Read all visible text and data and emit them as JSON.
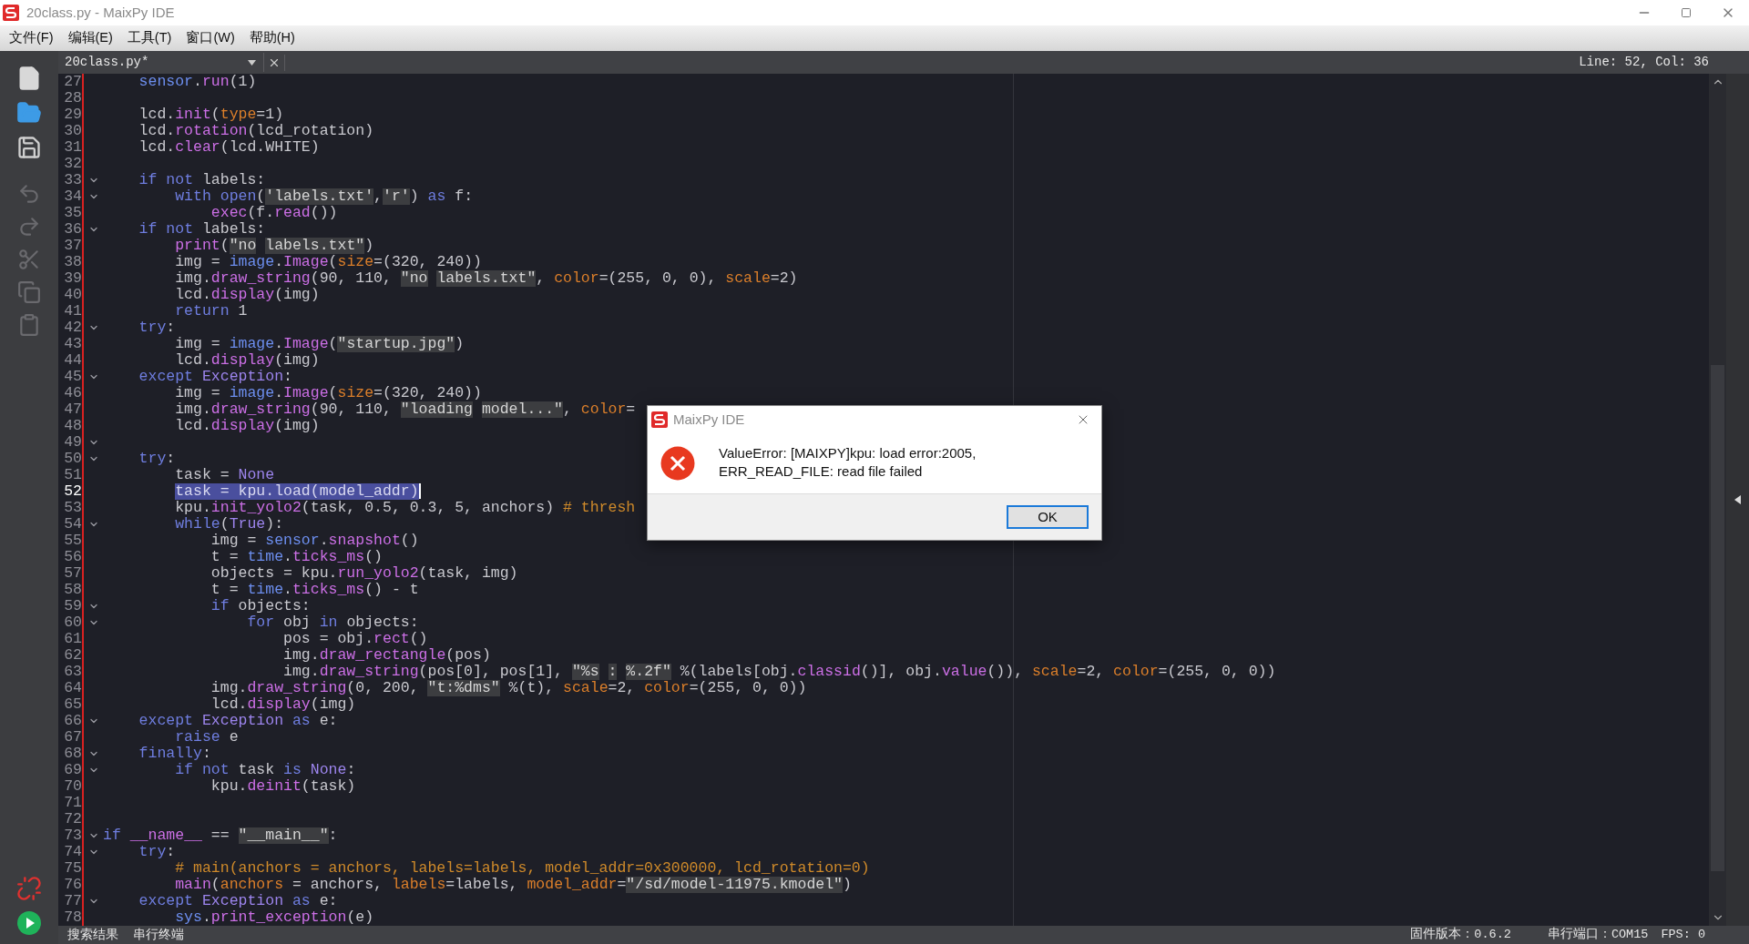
{
  "window": {
    "title": "20class.py - MaixPy IDE"
  },
  "menu": [
    "文件(F)",
    "编辑(E)",
    "工具(T)",
    "窗口(W)",
    "帮助(H)"
  ],
  "editor": {
    "tab": "20class.py*",
    "position": "Line: 52, Col: 36",
    "lines": [
      {
        "number": "27",
        "fold": false,
        "selected": false,
        "tokens": [
          {
            "kind": "module",
            "text": "    sensor"
          },
          {
            "kind": "plain",
            "text": "."
          },
          {
            "kind": "function",
            "text": "run"
          },
          {
            "kind": "plain",
            "text": "(1)"
          }
        ]
      },
      {
        "number": "28",
        "fold": false,
        "selected": false
      },
      {
        "number": "29",
        "fold": false,
        "selected": false,
        "tokens": [
          {
            "kind": "plain",
            "text": "    lcd."
          },
          {
            "kind": "function",
            "text": "init"
          },
          {
            "kind": "plain",
            "text": "("
          },
          {
            "kind": "param",
            "text": "type"
          },
          {
            "kind": "plain",
            "text": "=1)"
          }
        ]
      },
      {
        "number": "30",
        "fold": false,
        "selected": false,
        "tokens": [
          {
            "kind": "plain",
            "text": "    lcd."
          },
          {
            "kind": "function",
            "text": "rotation"
          },
          {
            "kind": "plain",
            "text": "(lcd_rotation)"
          }
        ]
      },
      {
        "number": "31",
        "fold": false,
        "selected": false,
        "tokens": [
          {
            "kind": "plain",
            "text": "    lcd."
          },
          {
            "kind": "function",
            "text": "clear"
          },
          {
            "kind": "plain",
            "text": "(lcd.WHITE)"
          }
        ]
      },
      {
        "number": "32",
        "fold": false,
        "selected": false
      },
      {
        "number": "33",
        "fold": true,
        "selected": false,
        "tokens": [
          {
            "kind": "keyword",
            "text": "    if"
          },
          {
            "kind": "keyword",
            "text": " not"
          },
          {
            "kind": "plain",
            "text": " labels:"
          }
        ]
      },
      {
        "number": "34",
        "fold": true,
        "selected": false,
        "tokens": [
          {
            "kind": "keyword",
            "text": "        with"
          },
          {
            "kind": "keyword",
            "text": " open"
          },
          {
            "kind": "plain",
            "text": "("
          },
          {
            "kind": "string",
            "text": "'labels.txt'"
          },
          {
            "kind": "plain",
            "text": ","
          },
          {
            "kind": "string",
            "text": "'r'"
          },
          {
            "kind": "plain",
            "text": ")"
          },
          {
            "kind": "keyword",
            "text": " as"
          },
          {
            "kind": "plain",
            "text": " f:"
          }
        ]
      },
      {
        "number": "35",
        "fold": false,
        "selected": false,
        "tokens": [
          {
            "kind": "function",
            "text": "            exec"
          },
          {
            "kind": "plain",
            "text": "(f."
          },
          {
            "kind": "function",
            "text": "read"
          },
          {
            "kind": "plain",
            "text": "())"
          }
        ]
      },
      {
        "number": "36",
        "fold": true,
        "selected": false,
        "tokens": [
          {
            "kind": "keyword",
            "text": "    if"
          },
          {
            "kind": "keyword",
            "text": " not"
          },
          {
            "kind": "plain",
            "text": " labels:"
          }
        ]
      },
      {
        "number": "37",
        "fold": false,
        "selected": false,
        "tokens": [
          {
            "kind": "function",
            "text": "        print"
          },
          {
            "kind": "plain",
            "text": "("
          },
          {
            "kind": "string",
            "text": "\"no"
          },
          {
            "kind": "string",
            "text": " labels.txt\""
          },
          {
            "kind": "plain",
            "text": ")"
          }
        ]
      },
      {
        "number": "38",
        "fold": false,
        "selected": false,
        "tokens": [
          {
            "kind": "plain",
            "text": "        img = "
          },
          {
            "kind": "module",
            "text": "image"
          },
          {
            "kind": "plain",
            "text": "."
          },
          {
            "kind": "function",
            "text": "Image"
          },
          {
            "kind": "plain",
            "text": "("
          },
          {
            "kind": "param",
            "text": "size"
          },
          {
            "kind": "plain",
            "text": "=(320, 240))"
          }
        ]
      },
      {
        "number": "39",
        "fold": false,
        "selected": false,
        "tokens": [
          {
            "kind": "plain",
            "text": "        img."
          },
          {
            "kind": "function",
            "text": "draw_string"
          },
          {
            "kind": "plain",
            "text": "(90, 110, "
          },
          {
            "kind": "string",
            "text": "\"no"
          },
          {
            "kind": "string",
            "text": " labels.txt\""
          },
          {
            "kind": "plain",
            "text": ", "
          },
          {
            "kind": "param",
            "text": "color"
          },
          {
            "kind": "plain",
            "text": "=(255, 0, 0), "
          },
          {
            "kind": "param",
            "text": "scale"
          },
          {
            "kind": "plain",
            "text": "=2)"
          }
        ]
      },
      {
        "number": "40",
        "fold": false,
        "selected": false,
        "tokens": [
          {
            "kind": "plain",
            "text": "        lcd."
          },
          {
            "kind": "function",
            "text": "display"
          },
          {
            "kind": "plain",
            "text": "(img)"
          }
        ]
      },
      {
        "number": "41",
        "fold": false,
        "selected": false,
        "tokens": [
          {
            "kind": "keyword",
            "text": "        return"
          },
          {
            "kind": "plain",
            "text": " 1"
          }
        ]
      },
      {
        "number": "42",
        "fold": true,
        "selected": false,
        "tokens": [
          {
            "kind": "keyword",
            "text": "    try"
          },
          {
            "kind": "plain",
            "text": ":"
          }
        ]
      },
      {
        "number": "43",
        "fold": false,
        "selected": false,
        "tokens": [
          {
            "kind": "plain",
            "text": "        img = "
          },
          {
            "kind": "module",
            "text": "image"
          },
          {
            "kind": "plain",
            "text": "."
          },
          {
            "kind": "function",
            "text": "Image"
          },
          {
            "kind": "plain",
            "text": "("
          },
          {
            "kind": "string",
            "text": "\"startup.jpg\""
          },
          {
            "kind": "plain",
            "text": ")"
          }
        ]
      },
      {
        "number": "44",
        "fold": false,
        "selected": false,
        "tokens": [
          {
            "kind": "plain",
            "text": "        lcd."
          },
          {
            "kind": "function",
            "text": "display"
          },
          {
            "kind": "plain",
            "text": "(img)"
          }
        ]
      },
      {
        "number": "45",
        "fold": true,
        "selected": false,
        "tokens": [
          {
            "kind": "keyword",
            "text": "    except"
          },
          {
            "kind": "builtin",
            "text": " Exception"
          },
          {
            "kind": "plain",
            "text": ":"
          }
        ]
      },
      {
        "number": "46",
        "fold": false,
        "selected": false,
        "tokens": [
          {
            "kind": "plain",
            "text": "        img = "
          },
          {
            "kind": "module",
            "text": "image"
          },
          {
            "kind": "plain",
            "text": "."
          },
          {
            "kind": "function",
            "text": "Image"
          },
          {
            "kind": "plain",
            "text": "("
          },
          {
            "kind": "param",
            "text": "size"
          },
          {
            "kind": "plain",
            "text": "=(320, 240))"
          }
        ]
      },
      {
        "number": "47",
        "fold": false,
        "selected": false,
        "tokens": [
          {
            "kind": "plain",
            "text": "        img."
          },
          {
            "kind": "function",
            "text": "draw_string"
          },
          {
            "kind": "plain",
            "text": "(90, 110, "
          },
          {
            "kind": "string",
            "text": "\"loading"
          },
          {
            "kind": "string",
            "text": " model...\""
          },
          {
            "kind": "plain",
            "text": ", "
          },
          {
            "kind": "param",
            "text": "color"
          },
          {
            "kind": "plain",
            "text": "="
          }
        ]
      },
      {
        "number": "48",
        "fold": false,
        "selected": false,
        "tokens": [
          {
            "kind": "plain",
            "text": "        lcd."
          },
          {
            "kind": "function",
            "text": "display"
          },
          {
            "kind": "plain",
            "text": "(img)"
          }
        ]
      },
      {
        "number": "49",
        "fold": true,
        "selected": false
      },
      {
        "number": "50",
        "fold": true,
        "selected": false,
        "tokens": [
          {
            "kind": "keyword",
            "text": "    try"
          },
          {
            "kind": "plain",
            "text": ":"
          }
        ]
      },
      {
        "number": "51",
        "fold": false,
        "selected": false,
        "tokens": [
          {
            "kind": "plain",
            "text": "        task = "
          },
          {
            "kind": "builtin",
            "text": "None"
          }
        ]
      },
      {
        "number": "52",
        "fold": false,
        "selected": true,
        "tokens": [
          {
            "kind": "selection",
            "text": "        task = kpu.load(model_addr)"
          }
        ]
      },
      {
        "number": "53",
        "fold": false,
        "selected": false,
        "tokens": [
          {
            "kind": "plain",
            "text": "        kpu."
          },
          {
            "kind": "function",
            "text": "init_yolo2"
          },
          {
            "kind": "plain",
            "text": "(task, 0.5, 0.3, 5, anchors) "
          },
          {
            "kind": "comment",
            "text": "# thresh"
          }
        ]
      },
      {
        "number": "54",
        "fold": true,
        "selected": false,
        "tokens": [
          {
            "kind": "keyword",
            "text": "        while"
          },
          {
            "kind": "plain",
            "text": "("
          },
          {
            "kind": "builtin",
            "text": "True"
          },
          {
            "kind": "plain",
            "text": "):"
          }
        ]
      },
      {
        "number": "55",
        "fold": false,
        "selected": false,
        "tokens": [
          {
            "kind": "plain",
            "text": "            img = "
          },
          {
            "kind": "module",
            "text": "sensor"
          },
          {
            "kind": "plain",
            "text": "."
          },
          {
            "kind": "function",
            "text": "snapshot"
          },
          {
            "kind": "plain",
            "text": "()"
          }
        ]
      },
      {
        "number": "56",
        "fold": false,
        "selected": false,
        "tokens": [
          {
            "kind": "plain",
            "text": "            t = "
          },
          {
            "kind": "module",
            "text": "time"
          },
          {
            "kind": "plain",
            "text": "."
          },
          {
            "kind": "function",
            "text": "ticks_ms"
          },
          {
            "kind": "plain",
            "text": "()"
          }
        ]
      },
      {
        "number": "57",
        "fold": false,
        "selected": false,
        "tokens": [
          {
            "kind": "plain",
            "text": "            objects = kpu."
          },
          {
            "kind": "function",
            "text": "run_yolo2"
          },
          {
            "kind": "plain",
            "text": "(task, img)"
          }
        ]
      },
      {
        "number": "58",
        "fold": false,
        "selected": false,
        "tokens": [
          {
            "kind": "plain",
            "text": "            t = "
          },
          {
            "kind": "module",
            "text": "time"
          },
          {
            "kind": "plain",
            "text": "."
          },
          {
            "kind": "function",
            "text": "ticks_ms"
          },
          {
            "kind": "plain",
            "text": "() - t"
          }
        ]
      },
      {
        "number": "59",
        "fold": true,
        "selected": false,
        "tokens": [
          {
            "kind": "keyword",
            "text": "            if"
          },
          {
            "kind": "plain",
            "text": " objects:"
          }
        ]
      },
      {
        "number": "60",
        "fold": true,
        "selected": false,
        "tokens": [
          {
            "kind": "keyword",
            "text": "                for"
          },
          {
            "kind": "plain",
            "text": " obj "
          },
          {
            "kind": "keyword",
            "text": "in"
          },
          {
            "kind": "plain",
            "text": " objects:"
          }
        ]
      },
      {
        "number": "61",
        "fold": false,
        "selected": false,
        "tokens": [
          {
            "kind": "plain",
            "text": "                    pos = obj."
          },
          {
            "kind": "function",
            "text": "rect"
          },
          {
            "kind": "plain",
            "text": "()"
          }
        ]
      },
      {
        "number": "62",
        "fold": false,
        "selected": false,
        "tokens": [
          {
            "kind": "plain",
            "text": "                    img."
          },
          {
            "kind": "function",
            "text": "draw_rectangle"
          },
          {
            "kind": "plain",
            "text": "(pos)"
          }
        ]
      },
      {
        "number": "63",
        "fold": false,
        "selected": false,
        "tokens": [
          {
            "kind": "plain",
            "text": "                    img."
          },
          {
            "kind": "function",
            "text": "draw_string"
          },
          {
            "kind": "plain",
            "text": "(pos[0], pos[1], "
          },
          {
            "kind": "string",
            "text": "\"%s"
          },
          {
            "kind": "string",
            "text": " :"
          },
          {
            "kind": "string",
            "text": " %.2f\""
          },
          {
            "kind": "plain",
            "text": " %(labels[obj."
          },
          {
            "kind": "function",
            "text": "classid"
          },
          {
            "kind": "plain",
            "text": "()], obj."
          },
          {
            "kind": "function",
            "text": "value"
          },
          {
            "kind": "plain",
            "text": "()), "
          },
          {
            "kind": "param",
            "text": "scale"
          },
          {
            "kind": "plain",
            "text": "=2, "
          },
          {
            "kind": "param",
            "text": "color"
          },
          {
            "kind": "plain",
            "text": "=(255, 0, 0))"
          }
        ]
      },
      {
        "number": "64",
        "fold": false,
        "selected": false,
        "tokens": [
          {
            "kind": "plain",
            "text": "            img."
          },
          {
            "kind": "function",
            "text": "draw_string"
          },
          {
            "kind": "plain",
            "text": "(0, 200, "
          },
          {
            "kind": "string",
            "text": "\"t:%dms\""
          },
          {
            "kind": "plain",
            "text": " %(t), "
          },
          {
            "kind": "param",
            "text": "scale"
          },
          {
            "kind": "plain",
            "text": "=2, "
          },
          {
            "kind": "param",
            "text": "color"
          },
          {
            "kind": "plain",
            "text": "=(255, 0, 0))"
          }
        ]
      },
      {
        "number": "65",
        "fold": false,
        "selected": false,
        "tokens": [
          {
            "kind": "plain",
            "text": "            lcd."
          },
          {
            "kind": "function",
            "text": "display"
          },
          {
            "kind": "plain",
            "text": "(img)"
          }
        ]
      },
      {
        "number": "66",
        "fold": true,
        "selected": false,
        "tokens": [
          {
            "kind": "keyword",
            "text": "    except"
          },
          {
            "kind": "builtin",
            "text": " Exception"
          },
          {
            "kind": "keyword",
            "text": " as"
          },
          {
            "kind": "plain",
            "text": " e:"
          }
        ]
      },
      {
        "number": "67",
        "fold": false,
        "selected": false,
        "tokens": [
          {
            "kind": "keyword",
            "text": "        raise"
          },
          {
            "kind": "plain",
            "text": " e"
          }
        ]
      },
      {
        "number": "68",
        "fold": true,
        "selected": false,
        "tokens": [
          {
            "kind": "keyword",
            "text": "    finally"
          },
          {
            "kind": "plain",
            "text": ":"
          }
        ]
      },
      {
        "number": "69",
        "fold": true,
        "selected": false,
        "tokens": [
          {
            "kind": "keyword",
            "text": "        if"
          },
          {
            "kind": "keyword",
            "text": " not"
          },
          {
            "kind": "plain",
            "text": " task "
          },
          {
            "kind": "keyword",
            "text": "is"
          },
          {
            "kind": "builtin",
            "text": " None"
          },
          {
            "kind": "plain",
            "text": ":"
          }
        ]
      },
      {
        "number": "70",
        "fold": false,
        "selected": false,
        "tokens": [
          {
            "kind": "plain",
            "text": "            kpu."
          },
          {
            "kind": "function",
            "text": "deinit"
          },
          {
            "kind": "plain",
            "text": "(task)"
          }
        ]
      },
      {
        "number": "71",
        "fold": false,
        "selected": false
      },
      {
        "number": "72",
        "fold": false,
        "selected": false
      },
      {
        "number": "73",
        "fold": true,
        "selected": false,
        "tokens": [
          {
            "kind": "keyword",
            "text": "if"
          },
          {
            "kind": "function",
            "text": " __name__"
          },
          {
            "kind": "plain",
            "text": " == "
          },
          {
            "kind": "string",
            "text": "\"__main__\""
          },
          {
            "kind": "plain",
            "text": ":"
          }
        ]
      },
      {
        "number": "74",
        "fold": true,
        "selected": false,
        "tokens": [
          {
            "kind": "keyword",
            "text": "    try"
          },
          {
            "kind": "plain",
            "text": ":"
          }
        ]
      },
      {
        "number": "75",
        "fold": false,
        "selected": false,
        "tokens": [
          {
            "kind": "comment",
            "text": "        # main(anchors = anchors, labels=labels, model_addr=0x300000, lcd_rotation=0)"
          }
        ]
      },
      {
        "number": "76",
        "fold": false,
        "selected": false,
        "tokens": [
          {
            "kind": "function",
            "text": "        main"
          },
          {
            "kind": "plain",
            "text": "("
          },
          {
            "kind": "param",
            "text": "anchors"
          },
          {
            "kind": "plain",
            "text": " = anchors, "
          },
          {
            "kind": "param",
            "text": "labels"
          },
          {
            "kind": "plain",
            "text": "=labels, "
          },
          {
            "kind": "param",
            "text": "model_addr"
          },
          {
            "kind": "plain",
            "text": "="
          },
          {
            "kind": "string",
            "text": "\"/sd/model-11975.kmodel\""
          },
          {
            "kind": "plain",
            "text": ")"
          }
        ]
      },
      {
        "number": "77",
        "fold": true,
        "selected": false,
        "tokens": [
          {
            "kind": "keyword",
            "text": "    except"
          },
          {
            "kind": "builtin",
            "text": " Exception"
          },
          {
            "kind": "keyword",
            "text": " as"
          },
          {
            "kind": "plain",
            "text": " e:"
          }
        ]
      },
      {
        "number": "78",
        "fold": false,
        "selected": false,
        "tokens": [
          {
            "kind": "module",
            "text": "        sys"
          },
          {
            "kind": "plain",
            "text": "."
          },
          {
            "kind": "function",
            "text": "print_exception"
          },
          {
            "kind": "plain",
            "text": "(e)"
          }
        ]
      }
    ]
  },
  "dialog": {
    "title": "MaixPy IDE",
    "message": [
      "ValueError: [MAIXPY]kpu: load error:2005,",
      "ERR_READ_FILE: read file failed"
    ],
    "button": "OK"
  },
  "status_bar": {
    "tabs": [
      "搜索结果",
      "串行终端"
    ],
    "firmware": "固件版本：0.6.2",
    "port": "串行端口：COM15",
    "fps": "FPS: 0"
  }
}
